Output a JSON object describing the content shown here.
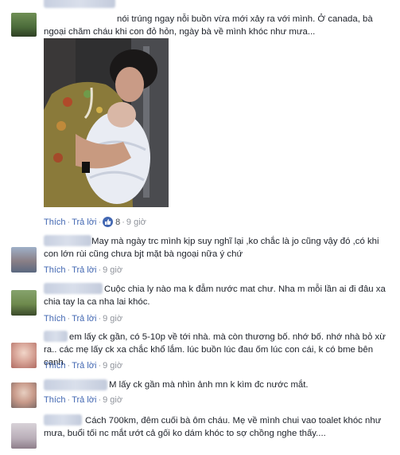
{
  "comments": [
    {
      "text": "nói trúng ngay nỗi buồn vừa mới xảy ra với mình. Ở canada, bà ngoại chăm cháu khi con đỏ hỏn, ngày bà về mình khóc như mưa...",
      "actions": {
        "like": "Thích",
        "reply": "Trả lời",
        "reactions": "8",
        "time": "9 giờ"
      },
      "photo": {
        "icon": "grandmother-kissing-baby-photo"
      }
    },
    {
      "text": "May mà ngày trc mình kịp suy nghĩ lại ,ko chắc là jo cũng vậy đó ,có khi con lớn rùi cũng chưa bjt mặt bà ngoại nữa ý chứ",
      "actions": {
        "like": "Thích",
        "reply": "Trả lời",
        "time": "9 giờ"
      }
    },
    {
      "text": "Cuộc chia ly nào ma k đẫm nước mat chư. Nha m mỗi lần ai đi đâu xa chia tay la ca nha lai khóc.",
      "actions": {
        "like": "Thích",
        "reply": "Trả lời",
        "time": "9 giờ"
      }
    },
    {
      "text": "em lấy ck gần, có 5-10p về tới nhà. mà còn thương bố. nhớ bố. nhớ nhà bỏ xừ ra.. các mẹ lấy ck xa chắc khổ lắm. lúc buồn lúc đau ốm lúc con cái, k có bme bên cạnh.",
      "actions": {
        "like": "Thích",
        "reply": "Trả lời",
        "time": "9 giờ"
      }
    },
    {
      "text": "M lấy ck gần mà nhìn ảnh mn k kìm đc nước mắt.",
      "actions": {
        "like": "Thích",
        "reply": "Trả lời",
        "time": "9 giờ"
      }
    },
    {
      "text": "Cách 700km, đêm cuối bà ôm cháu. Mẹ về mình chui vao toalet khóc như mưa, buổi tối nc mắt ướt cả gối ko dám khóc to sợ chồng nghe thấy....",
      "actions": {}
    }
  ],
  "colors": {
    "link": "#4267b2",
    "meta": "#90949c",
    "text": "#1d2129"
  }
}
